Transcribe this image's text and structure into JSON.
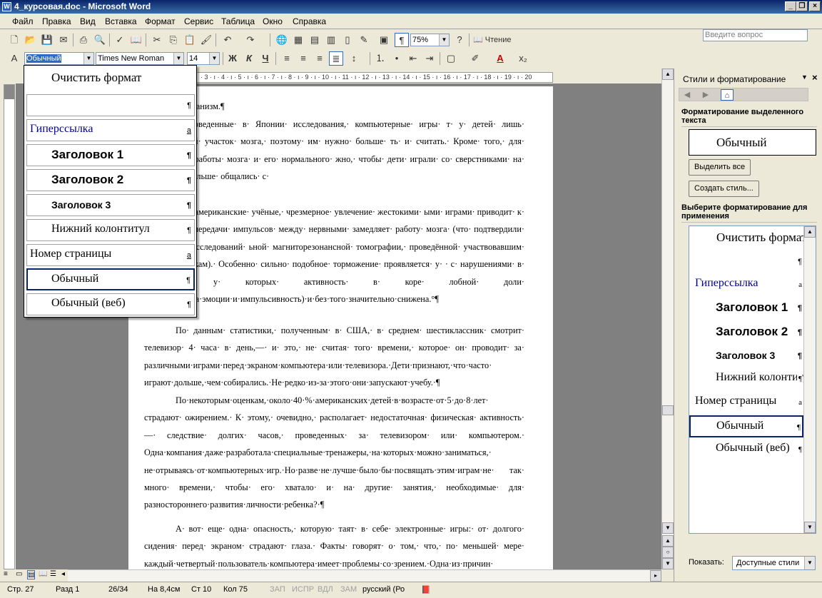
{
  "window": {
    "title": "4_курсовая.doc - Microsoft Word",
    "icon": "W"
  },
  "menu": [
    "Файл",
    "Правка",
    "Вид",
    "Вставка",
    "Формат",
    "Сервис",
    "Таблица",
    "Окно",
    "Справка"
  ],
  "ask_placeholder": "Введите вопрос",
  "toolbar": {
    "zoom": "75%",
    "reading": "Чтение"
  },
  "format_toolbar": {
    "style": "Обычный",
    "font": "Times New Roman",
    "size": "14",
    "bold": "Ж",
    "italic": "К",
    "underline": "Ч"
  },
  "ruler_marks": "· 3 · ı · 4 · ı · 5 · ı · 6 · ı · 7 · ı · 8 · ı · 9 · ı · 10 · ı · 11 · ı · 12 · ı · 13 · ı · 14 · ı · 15 · ı · 16 · ı · 17 · ı · 18 · ı · 19 · ı · 20",
  "style_dropdown": [
    {
      "label": "Очистить формат",
      "mark": ""
    },
    {
      "label": "",
      "mark": "¶"
    },
    {
      "label": "Гиперссылка",
      "mark": "a"
    },
    {
      "label": "Заголовок 1",
      "mark": "¶"
    },
    {
      "label": "Заголовок 2",
      "mark": "¶"
    },
    {
      "label": "Заголовок 3",
      "mark": "¶"
    },
    {
      "label": "Нижний колонтитул",
      "mark": "¶"
    },
    {
      "label": "Номер страницы",
      "mark": "a"
    },
    {
      "label": "Обычный",
      "mark": "¶"
    },
    {
      "label": "Обычный (веб)",
      "mark": "¶"
    }
  ],
  "document": {
    "paragraphs": [
      "йствие·на·организм.¶",
      "выявили· проведенные· в· Японии· исследования,· компьютерные· игры· т· у· детей· лишь· ограниченный· участок· мозга,· поэтому· им· нужно· больше· ть· и· считать.· Кроме· того,· для· стимуляции· работы· мозга· и· его· нормального· жно,· чтобы· дети· играли· со· сверстниками· на· воздухе· и· больше· общались· с·",
      "утверждают· американские· учёные,· чрезмерное· увлечение· жестокими· ыми· играми· приводит· к· нарушению· передачи· импульсов· между· нервными· замедляет· работу· мозга· (что· подтвердили· результаты· исследований· ьной· магниторезонансной· томографии,· проведённой· участвовавшим· в· и· подросткам).· Особенно· сильно· подобное· торможение· проявляется· у· · с· нарушениями· в· поведении,· у· которых· активность· в· коре· лобной· доли· в·том·числе·за·эмоции·и·импульсивность)·и·без·того·значительно·снижена.°¶",
      "По· данным· статистики,· полученным· в· США,· в· среднем· шестиклассник· смотрит· телевизор· 4· часа· в· день,—· и· это,· не· считая· того· времени,· которое· он· проводит· за· различными·играми·перед·экраном·компьютера·или·телевизора.·Дети·признают,·что·часто· играют·дольше,·чем·собирались.·Не·редко·из-за·этого·они·запускают·учебу.·¶",
      "По·некоторым·оценкам,·около·40·%·американских·детей·в·возрасте·от·5·до·8·лет· страдают· ожирением.· К· этому,· очевидно,· располагает· недостаточная· физическая· активность· —· следствие· долгих· часов,· проведенных· за· телевизором· или· компьютером.· Одна·компания·даже·разработала·специальные·тренажеры,·на·которых·можно·заниматься,· не·отрываясь·от·компьютерных·игр.·Но·разве·не·лучше·было·бы·посвящать·этим·играм·не· так· много· времени,· чтобы· его· хватало· и· на· другие· занятия,· необходимые· для· разностороннего·развития·личности·ребенка?·¶",
      "А· вот· еще· одна· опасность,· которую· таят· в· себе· электронные· игры:· от· долгого· сидения· перед· экраном· страдают· глаза.· Факты· говорят· о· том,· что,· по· меньшей· мере· каждый·четвертый·пользователь·компьютера·имеет·проблемы·со·зрением.·Одна·из·причин·"
    ]
  },
  "pane": {
    "title": "Стили и форматирование",
    "selected_heading": "Форматирование выделенного текста",
    "current_style": "Обычный",
    "select_all": "Выделить все",
    "new_style": "Создать стиль...",
    "apply_heading": "Выберите форматирование для применения",
    "styles": [
      {
        "label": "Очистить формат",
        "mark": ""
      },
      {
        "label": "",
        "mark": "¶"
      },
      {
        "label": "Гиперссылка",
        "mark": "a"
      },
      {
        "label": "Заголовок 1",
        "mark": "¶"
      },
      {
        "label": "Заголовок 2",
        "mark": "¶"
      },
      {
        "label": "Заголовок 3",
        "mark": "¶"
      },
      {
        "label": "Нижний колонтитул",
        "mark": "¶"
      },
      {
        "label": "Номер страницы",
        "mark": "a"
      },
      {
        "label": "Обычный",
        "mark": "¶"
      },
      {
        "label": "Обычный (веб)",
        "mark": "¶"
      }
    ],
    "show_label": "Показать:",
    "show_value": "Доступные стили"
  },
  "status": {
    "page": "Стр. 27",
    "section": "Разд 1",
    "pages": "26/34",
    "at": "На 8,4см",
    "line": "Ст 10",
    "col": "Кол 75",
    "rec": "ЗАП",
    "trk": "ИСПР",
    "ext": "ВДЛ",
    "ovr": "ЗАМ",
    "lang": "русский (Ро"
  }
}
